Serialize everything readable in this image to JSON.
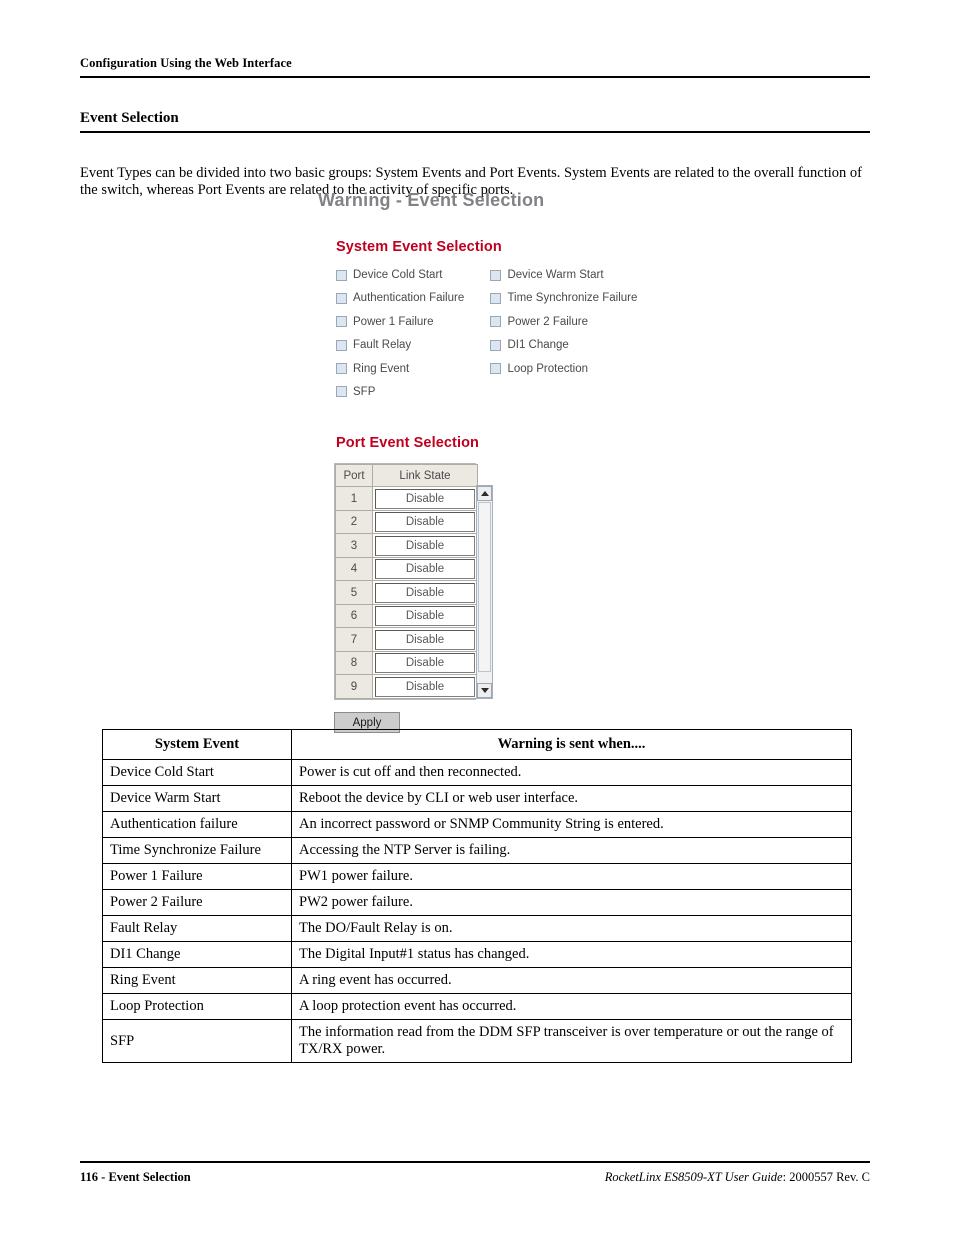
{
  "running_head": "Configuration Using the Web Interface",
  "section": {
    "title": "Event Selection",
    "intro": "Event Types can be divided into two basic groups: System Events and Port Events. System Events are related to the overall function of the switch, whereas Port Events are related to the activity of specific ports."
  },
  "webui": {
    "title": "Warning - Event Selection",
    "system_group_title": "System Event Selection",
    "system_events": [
      {
        "col1": "Device Cold Start",
        "col2": "Device Warm Start"
      },
      {
        "col1": "Authentication Failure",
        "col2": "Time Synchronize Failure"
      },
      {
        "col1": "Power 1 Failure",
        "col2": "Power 2 Failure"
      },
      {
        "col1": "Fault Relay",
        "col2": "DI1 Change"
      },
      {
        "col1": "Ring Event",
        "col2": "Loop Protection"
      },
      {
        "col1": "SFP",
        "col2": ""
      }
    ],
    "port_group_title": "Port Event Selection",
    "port_table": {
      "headers": [
        "Port",
        "Link State"
      ],
      "rows": [
        {
          "port": "1",
          "link_state": "Disable"
        },
        {
          "port": "2",
          "link_state": "Disable"
        },
        {
          "port": "3",
          "link_state": "Disable"
        },
        {
          "port": "4",
          "link_state": "Disable"
        },
        {
          "port": "5",
          "link_state": "Disable"
        },
        {
          "port": "6",
          "link_state": "Disable"
        },
        {
          "port": "7",
          "link_state": "Disable"
        },
        {
          "port": "8",
          "link_state": "Disable"
        },
        {
          "port": "9",
          "link_state": "Disable"
        }
      ]
    },
    "apply_label": "Apply",
    "colors": {
      "title_gray": "#808285",
      "group_red": "#c1001f",
      "checkbox_fill": "#dce6f1",
      "header_cell": "#ece9e2"
    }
  },
  "event_table": {
    "headers": [
      "System Event",
      "Warning is sent when...."
    ],
    "rows": [
      {
        "event": "Device Cold Start",
        "when": "Power is cut off and then reconnected."
      },
      {
        "event": "Device Warm Start",
        "when": "Reboot the device by CLI or web user interface."
      },
      {
        "event": "Authentication failure",
        "when": "An incorrect password or SNMP Community String is entered."
      },
      {
        "event": "Time Synchronize Failure",
        "when": "Accessing the NTP Server is failing."
      },
      {
        "event": "Power 1 Failure",
        "when": "PW1 power failure."
      },
      {
        "event": "Power 2 Failure",
        "when": "PW2 power failure."
      },
      {
        "event": "Fault Relay",
        "when": "The DO/Fault Relay is on."
      },
      {
        "event": "DI1 Change",
        "when": "The Digital Input#1 status has changed."
      },
      {
        "event": "Ring Event",
        "when": "A ring event has occurred."
      },
      {
        "event": "Loop Protection",
        "when": "A loop protection event has occurred."
      },
      {
        "event": "SFP",
        "when": "The information read from the DDM SFP transceiver is over temperature or out the range of TX/RX power."
      }
    ]
  },
  "footer": {
    "left": "116 - Event Selection",
    "right_italic": "RocketLinx ES8509-XT User Guide",
    "right_rest": ": 2000557 Rev. C"
  }
}
